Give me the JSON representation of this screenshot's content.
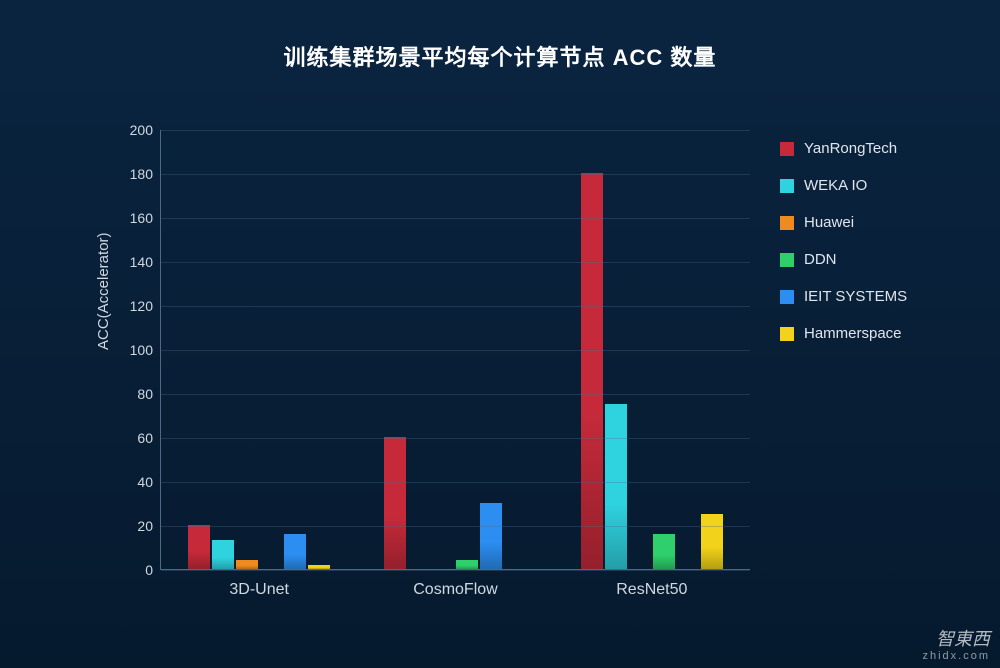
{
  "chart_data": {
    "type": "bar",
    "title": "训练集群场景平均每个计算节点 ACC 数量",
    "ylabel": "ACC(Accelerator)",
    "ylim": [
      0,
      200
    ],
    "yticks": [
      0,
      20,
      40,
      60,
      80,
      100,
      120,
      140,
      160,
      180,
      200
    ],
    "categories": [
      "3D-Unet",
      "CosmoFlow",
      "ResNet50"
    ],
    "series": [
      {
        "name": "YanRongTech",
        "color": "#c62a3a",
        "values": [
          20,
          60,
          180
        ]
      },
      {
        "name": "WEKA IO",
        "color": "#2fd3e0",
        "values": [
          13,
          0,
          75
        ]
      },
      {
        "name": "Huawei",
        "color": "#ef8a1f",
        "values": [
          4,
          0,
          0
        ]
      },
      {
        "name": "DDN",
        "color": "#2fcf6b",
        "values": [
          0,
          4,
          16
        ]
      },
      {
        "name": "IEIT SYSTEMS",
        "color": "#2b8ef0",
        "values": [
          16,
          30,
          0
        ]
      },
      {
        "name": "Hammerspace",
        "color": "#f2d21a",
        "values": [
          2,
          0,
          25
        ]
      }
    ]
  },
  "watermark": {
    "main": "智東西",
    "sub": "zhidx.com"
  }
}
